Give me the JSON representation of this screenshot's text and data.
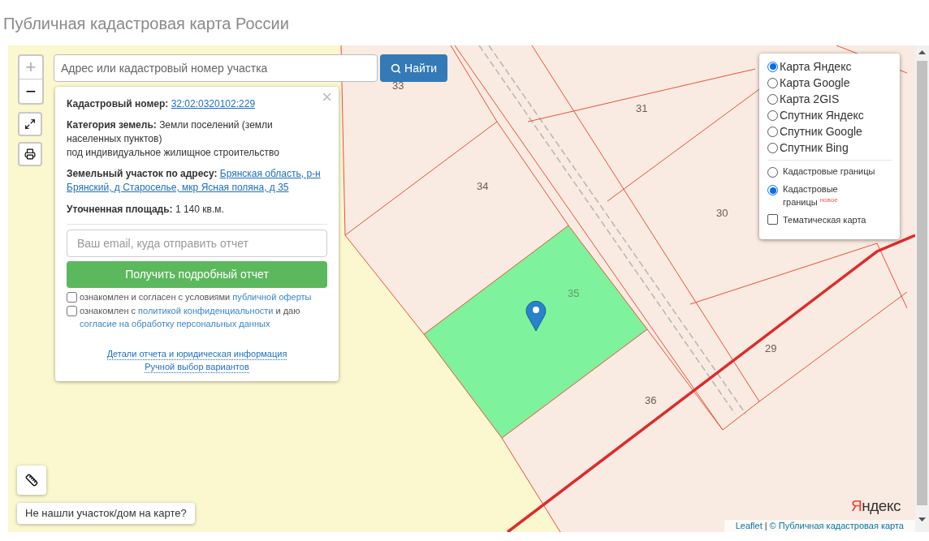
{
  "page_title": "Публичная кадастровая карта России",
  "search": {
    "placeholder": "Адрес или кадастровый номер участка",
    "button": "Найти"
  },
  "zoom": {
    "in": "+",
    "out": "−"
  },
  "popup": {
    "close": "×",
    "cadastral": {
      "label": "Кадастровый номер:",
      "value": "32:02:0320102:229"
    },
    "category": {
      "label": "Категория земель:",
      "lines": [
        "Земли поселений (земли населенных пунктов)",
        "под индивидуальное жилищное строительство"
      ]
    },
    "address": {
      "label": "Земельный участок по адресу:",
      "value": "Брянская область, р-н Брянский, д Староселье, мкр Ясная поляна, д 35"
    },
    "area": {
      "label": "Уточненная площадь:",
      "value": "1 140 кв.м."
    },
    "email": {
      "placeholder": "Ваш email, куда отправить отчет"
    },
    "submit": "Получить подробный отчет",
    "agreements": [
      {
        "checked": false,
        "segments": [
          {
            "text": "ознакомлен и согласен с условиями ",
            "link": false
          },
          {
            "text": "публичной оферты",
            "link": true
          }
        ]
      },
      {
        "checked": false,
        "segments": [
          {
            "text": "ознакомлен с ",
            "link": false
          },
          {
            "text": "политикой конфиденциальности",
            "link": true
          },
          {
            "text": " и даю ",
            "link": false
          },
          {
            "text": "согласие на обработку персональных данных",
            "link": true
          }
        ]
      }
    ],
    "links": [
      "Детали отчета и юридическая информация",
      "Ручной выбор вариантов"
    ]
  },
  "layers": {
    "base": [
      {
        "label": "Карта Яндекс",
        "selected": true
      },
      {
        "label": "Карта Google",
        "selected": false
      },
      {
        "label": "Карта 2GIS",
        "selected": false
      },
      {
        "label": "Спутник Яндекс",
        "selected": false
      },
      {
        "label": "Спутник Google",
        "selected": false
      },
      {
        "label": "Спутник Bing",
        "selected": false
      }
    ],
    "overlays": [
      {
        "kind": "radio",
        "label": "Кадастровые границы",
        "selected": false
      },
      {
        "kind": "radio",
        "label": "Кадастровые границы",
        "badge": "новое",
        "selected": true
      },
      {
        "kind": "checkbox",
        "label": "Тематическая карта",
        "checked": false
      }
    ]
  },
  "parcels": [
    {
      "label": "33"
    },
    {
      "label": "31"
    },
    {
      "label": "34"
    },
    {
      "label": "30"
    },
    {
      "label": "35",
      "selected": true
    },
    {
      "label": "29"
    },
    {
      "label": "36"
    }
  ],
  "help": "Не нашли участок/дом на карте?",
  "provider_logo": "Яндекс",
  "attribution": {
    "leaflet": "Leaflet",
    "separator": "|",
    "source": "© Публичная кадастровая карта"
  }
}
